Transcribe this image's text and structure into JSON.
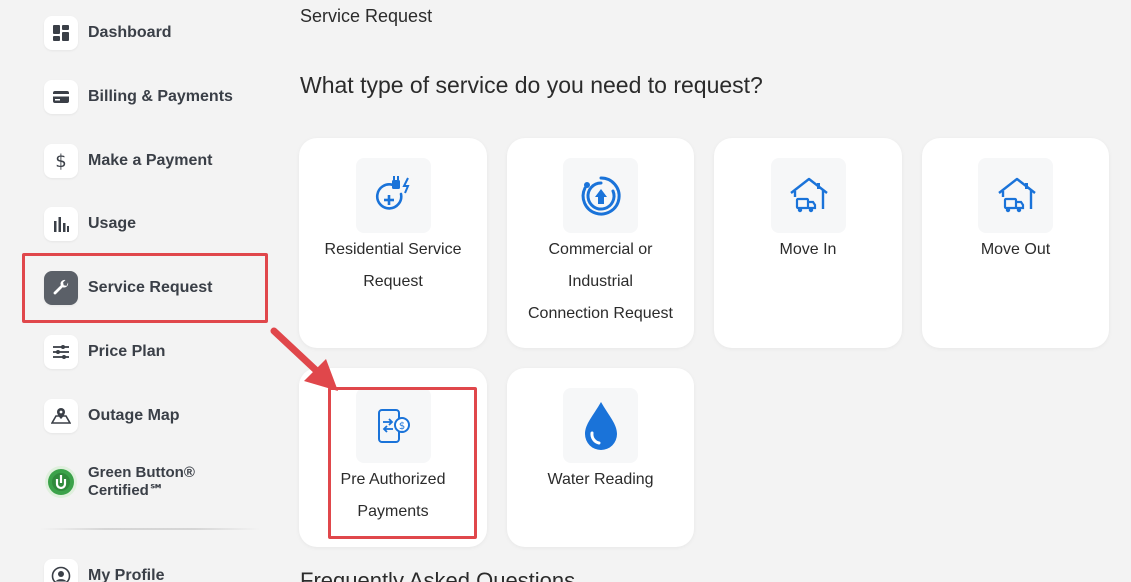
{
  "sidebar": {
    "items": [
      {
        "label": "Dashboard",
        "icon": "dashboard-icon"
      },
      {
        "label": "Billing & Payments",
        "icon": "credit-card-icon"
      },
      {
        "label": "Make a Payment",
        "icon": "dollar-icon"
      },
      {
        "label": "Usage",
        "icon": "bar-chart-icon"
      },
      {
        "label": "Service Request",
        "icon": "wrench-icon",
        "active": true
      },
      {
        "label": "Price Plan",
        "icon": "sliders-icon"
      },
      {
        "label": "Outage Map",
        "icon": "map-pin-icon"
      },
      {
        "label_line1": "Green Button®",
        "label_line2": "Certified℠",
        "icon": "green-button-logo"
      },
      {
        "label": "My Profile",
        "icon": "user-circle-icon"
      }
    ]
  },
  "main": {
    "breadcrumb": "Service Request",
    "heading": "What type of service do you need to request?",
    "cards": [
      {
        "line1": "Residential Service",
        "line2": "Request",
        "icon": "plug-add-icon"
      },
      {
        "line1": "Commercial or",
        "line2": "Industrial",
        "line3": "Connection Request",
        "icon": "commercial-connect-icon"
      },
      {
        "line1": "Move In",
        "icon": "house-truck-icon"
      },
      {
        "line1": "Move Out",
        "icon": "house-truck-icon"
      },
      {
        "line1": "Pre Authorized",
        "line2": "Payments",
        "icon": "phone-payment-icon"
      },
      {
        "line1": "Water Reading",
        "icon": "water-drop-icon"
      }
    ],
    "next_section_heading": "Frequently Asked Questions"
  },
  "colors": {
    "accent_blue": "#1a73d9",
    "highlight_red": "#e0474b",
    "sidebar_active_bg": "#5b6068",
    "page_bg": "#f3f3f3",
    "green_logo": "#3ba24a"
  }
}
